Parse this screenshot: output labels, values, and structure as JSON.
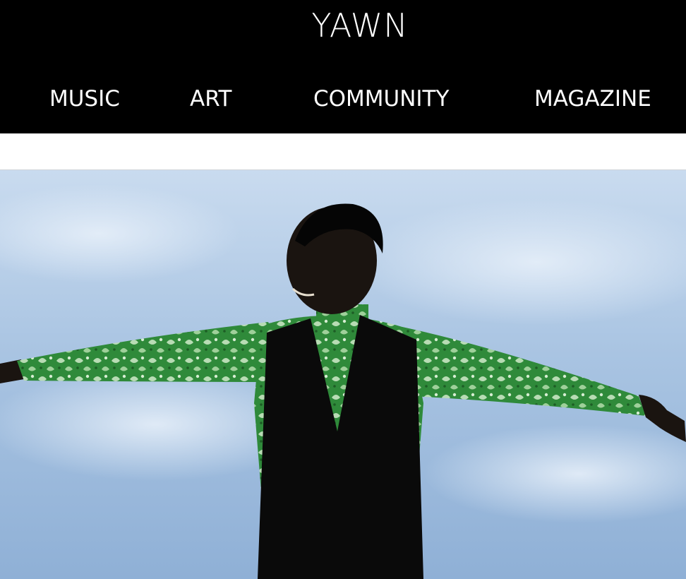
{
  "header": {
    "logo": "YAWN",
    "background": "#000000",
    "text_color": "#ffffff"
  },
  "nav": {
    "items": [
      {
        "label": "MUSIC"
      },
      {
        "label": "ART"
      },
      {
        "label": "COMMUNITY"
      },
      {
        "label": "MAGAZINE"
      }
    ]
  },
  "hero": {
    "sky_color": "#a9c4e2",
    "garment_color": "#2f8a3a",
    "vest_color": "#0a0a0a"
  }
}
